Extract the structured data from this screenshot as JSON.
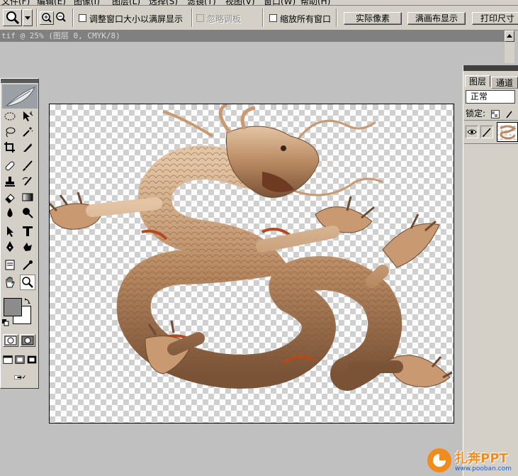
{
  "menubar": {
    "items": [
      "文件(F)",
      "编辑(E)",
      "图像(I)",
      "图层(L)",
      "选择(S)",
      "滤镜(T)",
      "视图(V)",
      "窗口(W)",
      "帮助(H)"
    ]
  },
  "options_bar": {
    "checkboxes": [
      {
        "label": "调整窗口大小以满屏显示",
        "checked": false,
        "disabled": false
      },
      {
        "label": "忽略调板",
        "checked": false,
        "disabled": true
      },
      {
        "label": "缩放所有窗口",
        "checked": false,
        "disabled": false
      }
    ],
    "buttons": [
      "实际像素",
      "满画布显示",
      "打印尺寸"
    ]
  },
  "document": {
    "title": "tif @ 25% (图层 0, CMYK/8)"
  },
  "colors": {
    "ui_face": "#d4d0c8",
    "workspace": "#c0c0c0",
    "title_bar": "#808080",
    "foreground_swatch": "#8c8c8c",
    "background_swatch": "#ffffff",
    "dragon": "#b98a62"
  },
  "layers_panel": {
    "tabs": [
      "图层",
      "通道"
    ],
    "blend_mode": "正常",
    "lock_label": "锁定:"
  },
  "watermark": {
    "brand": "扎奔PPT",
    "url": "www.pooban.com"
  }
}
